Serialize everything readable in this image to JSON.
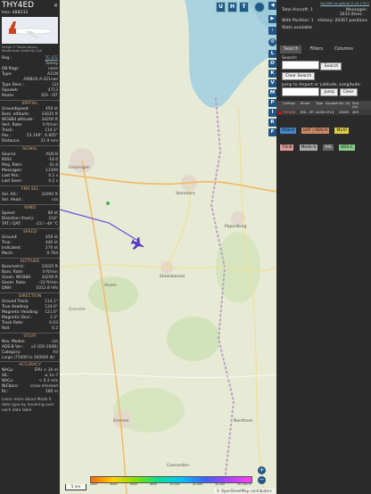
{
  "left": {
    "callsign": "THY4ED",
    "hex_line": "Hex:  4BB232",
    "photo_credit": "Image © Tobias Noyes - Kazakhstan Spotting Club",
    "reg_label": "Reg.:",
    "reg_value": "TC-LTE",
    "country": "Turkey",
    "db_flags_label": "DB flags:",
    "db_flags_value": "none",
    "type_label": "Type:",
    "type_value": "A21N",
    "aircraft_name": "AIRBUS A-321neo",
    "type_desc_label": "Type Desc.:",
    "type_desc_value": "L2J",
    "squawk_label": "Squawk:",
    "squawk_value": "4713",
    "route_label": "Route:",
    "route_value": "EDI - IST",
    "spatial_title": "SPATIAL",
    "spatial_rows": [
      {
        "k": "Groundspeed:",
        "v": "459 kt"
      },
      {
        "k": "Baro. altitude:",
        "v": "33025 ft"
      },
      {
        "k": "WGS84 altitude:",
        "v": "34200 ft"
      },
      {
        "k": "Vert. Rate:",
        "v": "0 ft/min"
      },
      {
        "k": "Track:",
        "v": "114.1°"
      },
      {
        "k": "Pos.:",
        "v": "53.199°, 6.805°"
      },
      {
        "k": "Distance:",
        "v": "31.9 nmi"
      }
    ],
    "signal_title": "SIGNAL",
    "signal_rows": [
      {
        "k": "Source:",
        "v": "ADS-B"
      },
      {
        "k": "RSSI:",
        "v": "-18.6"
      },
      {
        "k": "Msg. Rate:",
        "v": "41.8"
      },
      {
        "k": "Messages:",
        "v": "13399"
      },
      {
        "k": "Last Pos.:",
        "v": "0.2 s"
      },
      {
        "k": "Last Seen:",
        "v": "0.2 s"
      }
    ],
    "fms_title": "FMS SEL",
    "fms_rows": [
      {
        "k": "Sel. Alt.:",
        "v": "32992 ft"
      },
      {
        "k": "Sel. Head.:",
        "v": "n/a"
      }
    ],
    "wind_title": "WIND",
    "wind_rows": [
      {
        "k": "Speed:",
        "v": "86 kt"
      },
      {
        "k": "Direction (from):",
        "v": "218°"
      },
      {
        "k": "TAT / OAT:",
        "v": "-23 / -49 °C"
      }
    ],
    "speed_title": "SPEED",
    "speed_rows": [
      {
        "k": "Ground:",
        "v": "459 kt"
      },
      {
        "k": "True:",
        "v": "446 kt"
      },
      {
        "k": "Indicated:",
        "v": "270 kt"
      },
      {
        "k": "Mach:",
        "v": "0.764"
      }
    ],
    "altitude_title": "ALTITUDE",
    "altitude_rows": [
      {
        "k": "Barometric:",
        "v": "33025 ft"
      },
      {
        "k": "Baro. Rate:",
        "v": "0 ft/min"
      },
      {
        "k": "Geom. WGS84:",
        "v": "34200 ft"
      },
      {
        "k": "Geom. Rate:",
        "v": "-32 ft/min"
      },
      {
        "k": "QNH:",
        "v": "1012.8 hPa"
      }
    ],
    "direction_title": "DIRECTION",
    "direction_rows": [
      {
        "k": "Ground Track:",
        "v": "114.1°"
      },
      {
        "k": "True Heading:",
        "v": "124.6°"
      },
      {
        "k": "Magnetic Heading:",
        "v": "121.6°"
      },
      {
        "k": "Magnetic Decl.:",
        "v": "3.3°"
      },
      {
        "k": "Track Rate:",
        "v": "0.03"
      },
      {
        "k": "Roll:",
        "v": "0.2"
      }
    ],
    "stuff_title": "STUFF",
    "stuff_rows": [
      {
        "k": "Nav. Modes:",
        "v": "n/a"
      },
      {
        "k": "ADS-B Ver.:",
        "v": "v2 (DO-260B)"
      },
      {
        "k": "Category:",
        "v": "A3"
      }
    ],
    "category_desc": "Large (75000 to 300000 lb)",
    "accuracy_title": "ACCURACY",
    "accuracy_rows": [
      {
        "k": "NACp:",
        "v": "EPU < 30 m"
      },
      {
        "k": "SIL:",
        "v": "≤ 1e-7"
      },
      {
        "k": "NACv:",
        "v": "< 0.3 m/s"
      },
      {
        "k": "NICbaro:",
        "v": "cross-checked"
      },
      {
        "k": "Rc:",
        "v": "186 m"
      }
    ],
    "learn_more": "Learn more about Mode S data type by hovering over each data label."
  },
  "map": {
    "top_buttons": [
      "U",
      "H",
      "T"
    ],
    "side_buttons": [
      "L",
      "O",
      "K",
      "V",
      "M",
      "P",
      "I",
      "R",
      "F"
    ],
    "attribution": "© OpenStreetMap contributors.",
    "scale_label": "5 nm",
    "altitude_legend": [
      "2000",
      "4000",
      "6000",
      "8000",
      "10 000",
      "20 000",
      "30 000",
      "40 000 ft"
    ],
    "places": [
      "Groningen",
      "Assen",
      "Emmen",
      "Drenthe",
      "Coevorden",
      "Veendam",
      "Stadskanaal",
      "Nordhorn",
      "Papenburg"
    ],
    "zoom_in": "+",
    "zoom_out": "−"
  },
  "right": {
    "github_link": "tar1090 on github (3.14.1701)",
    "total_aircraft_label": "Total Aircraft:",
    "total_aircraft": "1",
    "messages_label": "Messages:",
    "messages_rate": "1615.9/sec",
    "with_position_label": "With Position:",
    "with_position": "1",
    "history_label": "History:",
    "history_value": "20367 positions",
    "stats_label": "Stats available",
    "tabs": [
      "Search",
      "Filters",
      "Columns"
    ],
    "search_label": "Search:",
    "search_button": "Search",
    "clear_search": "Clear Search",
    "jump_label": "Jump to Airport or Latitude, Longitude:",
    "jump_button": "Jump",
    "clear_button": "Clear",
    "table_headers": [
      "Callsign",
      "Route",
      "Type",
      "Squawk",
      "Alt. (ft)",
      "Spd. (kt)"
    ],
    "row": {
      "callsign": "THY4ED",
      "route": "EDI - IST",
      "type": "A21N",
      "squawk": "4713",
      "alt": "33025",
      "spd": "459"
    },
    "legend": [
      {
        "label": "ADS-B",
        "color": "#48c"
      },
      {
        "label": "UAT / ADS-R",
        "color": "#c86"
      },
      {
        "label": "MLAT",
        "color": "#dc4"
      },
      {
        "label": "TIS-B",
        "color": "#d99"
      },
      {
        "label": "Mode-S",
        "color": "#aaa"
      },
      {
        "label": "AIS",
        "color": "#666"
      },
      {
        "label": "ADS-C",
        "color": "#8c8"
      }
    ]
  }
}
